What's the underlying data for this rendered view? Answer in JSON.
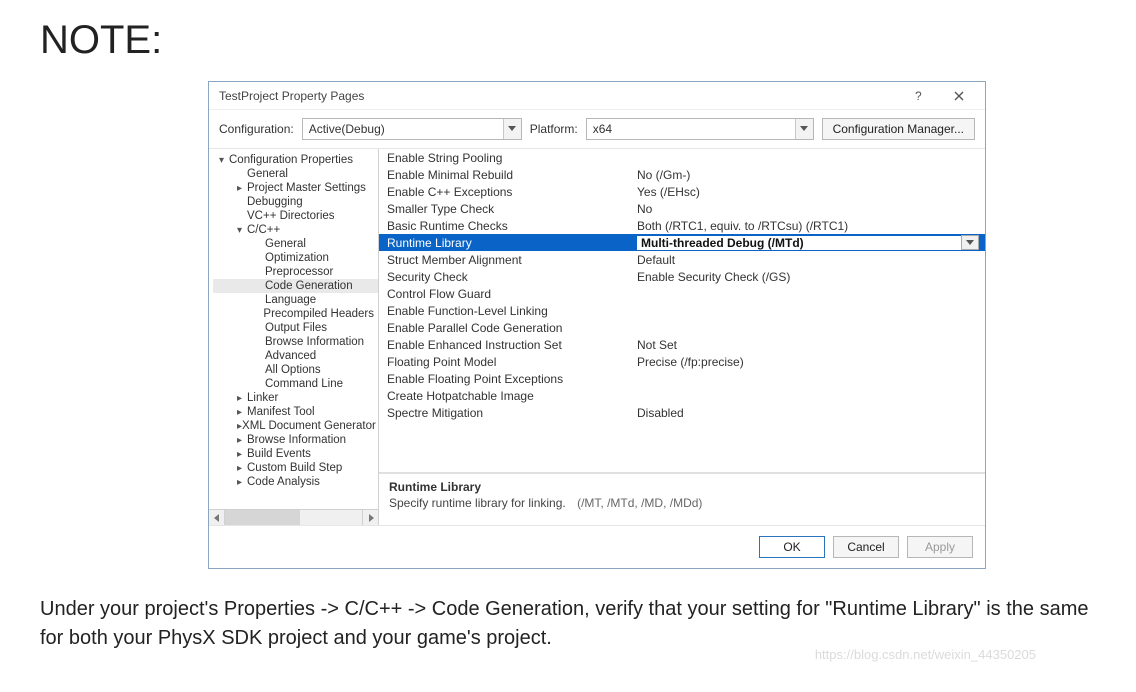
{
  "note_heading": "NOTE:",
  "dialog": {
    "title": "TestProject Property Pages",
    "config_label": "Configuration:",
    "config_value": "Active(Debug)",
    "platform_label": "Platform:",
    "platform_value": "x64",
    "config_mgr_label": "Configuration Manager..."
  },
  "tree": [
    {
      "label": "Configuration Properties",
      "indent": 0,
      "caret": "▾"
    },
    {
      "label": "General",
      "indent": 1,
      "caret": ""
    },
    {
      "label": "Project Master Settings",
      "indent": 1,
      "caret": "▸"
    },
    {
      "label": "Debugging",
      "indent": 1,
      "caret": ""
    },
    {
      "label": "VC++ Directories",
      "indent": 1,
      "caret": ""
    },
    {
      "label": "C/C++",
      "indent": 1,
      "caret": "▾"
    },
    {
      "label": "General",
      "indent": 2,
      "caret": ""
    },
    {
      "label": "Optimization",
      "indent": 2,
      "caret": ""
    },
    {
      "label": "Preprocessor",
      "indent": 2,
      "caret": ""
    },
    {
      "label": "Code Generation",
      "indent": 2,
      "caret": "",
      "selected": true
    },
    {
      "label": "Language",
      "indent": 2,
      "caret": ""
    },
    {
      "label": "Precompiled Headers",
      "indent": 2,
      "caret": ""
    },
    {
      "label": "Output Files",
      "indent": 2,
      "caret": ""
    },
    {
      "label": "Browse Information",
      "indent": 2,
      "caret": ""
    },
    {
      "label": "Advanced",
      "indent": 2,
      "caret": ""
    },
    {
      "label": "All Options",
      "indent": 2,
      "caret": ""
    },
    {
      "label": "Command Line",
      "indent": 2,
      "caret": ""
    },
    {
      "label": "Linker",
      "indent": 1,
      "caret": "▸"
    },
    {
      "label": "Manifest Tool",
      "indent": 1,
      "caret": "▸"
    },
    {
      "label": "XML Document Generator",
      "indent": 1,
      "caret": "▸"
    },
    {
      "label": "Browse Information",
      "indent": 1,
      "caret": "▸"
    },
    {
      "label": "Build Events",
      "indent": 1,
      "caret": "▸"
    },
    {
      "label": "Custom Build Step",
      "indent": 1,
      "caret": "▸"
    },
    {
      "label": "Code Analysis",
      "indent": 1,
      "caret": "▸"
    }
  ],
  "grid": [
    {
      "name": "Enable String Pooling",
      "value": ""
    },
    {
      "name": "Enable Minimal Rebuild",
      "value": "No (/Gm-)"
    },
    {
      "name": "Enable C++ Exceptions",
      "value": "Yes (/EHsc)"
    },
    {
      "name": "Smaller Type Check",
      "value": "No"
    },
    {
      "name": "Basic Runtime Checks",
      "value": "Both (/RTC1, equiv. to /RTCsu) (/RTC1)"
    },
    {
      "name": "Runtime Library",
      "value": "Multi-threaded Debug (/MTd)",
      "selected": true
    },
    {
      "name": "Struct Member Alignment",
      "value": "Default"
    },
    {
      "name": "Security Check",
      "value": "Enable Security Check (/GS)"
    },
    {
      "name": "Control Flow Guard",
      "value": ""
    },
    {
      "name": "Enable Function-Level Linking",
      "value": ""
    },
    {
      "name": "Enable Parallel Code Generation",
      "value": ""
    },
    {
      "name": "Enable Enhanced Instruction Set",
      "value": "Not Set"
    },
    {
      "name": "Floating Point Model",
      "value": "Precise (/fp:precise)"
    },
    {
      "name": "Enable Floating Point Exceptions",
      "value": ""
    },
    {
      "name": "Create Hotpatchable Image",
      "value": ""
    },
    {
      "name": "Spectre Mitigation",
      "value": "Disabled"
    }
  ],
  "description": {
    "title": "Runtime Library",
    "body": "Specify runtime library for linking.",
    "options": "(/MT, /MTd, /MD, /MDd)"
  },
  "footer": {
    "ok": "OK",
    "cancel": "Cancel",
    "apply": "Apply"
  },
  "caption": "Under your project's Properties -> C/C++ -> Code Generation, verify that your setting for \"Runtime Library\" is the same for both your PhysX SDK project and your game's project.",
  "watermark": "https://blog.csdn.net/weixin_44350205"
}
